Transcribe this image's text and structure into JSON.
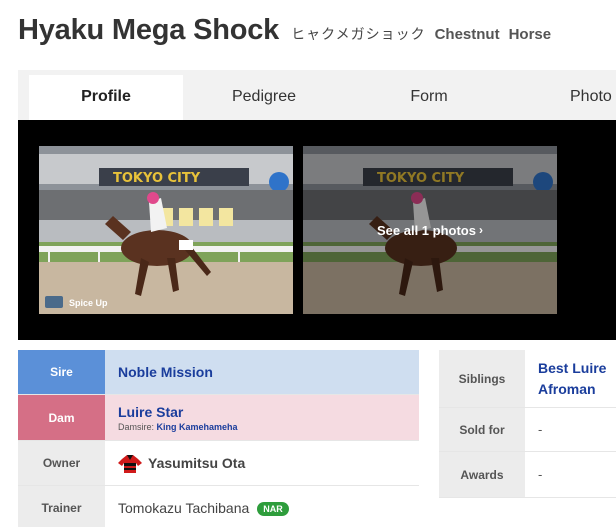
{
  "header": {
    "name": "Hyaku Mega Shock",
    "kana": "ヒャクメガショック",
    "color": "Chestnut",
    "type": "Horse"
  },
  "tabs": [
    {
      "label": "Profile",
      "active": true
    },
    {
      "label": "Pedigree",
      "active": false
    },
    {
      "label": "Form",
      "active": false
    },
    {
      "label": "Photo",
      "active": false
    }
  ],
  "gallery": {
    "credit": "Spice Up",
    "see_all": "See all 1 photos"
  },
  "profile": {
    "sire": {
      "label": "Sire",
      "value": "Noble Mission"
    },
    "dam": {
      "label": "Dam",
      "value": "Luire Star",
      "damsire_label": "Damsire:",
      "damsire": "King Kamehameha"
    },
    "owner": {
      "label": "Owner",
      "value": "Yasumitsu Ota"
    },
    "trainer": {
      "label": "Trainer",
      "value": "Tomokazu Tachibana",
      "badge": "NAR"
    }
  },
  "side": {
    "siblings": {
      "label": "Siblings",
      "values": [
        "Best Luire",
        "Afroman"
      ]
    },
    "sold_for": {
      "label": "Sold for",
      "value": "-"
    },
    "awards": {
      "label": "Awards",
      "value": "-"
    }
  },
  "colors": {
    "sire_label_bg": "#5b90d8",
    "sire_value_bg": "#cfdef0",
    "dam_label_bg": "#d56f86",
    "dam_value_bg": "#f5dbe1",
    "link": "#1a3d9c",
    "badge_nar": "#2e9d3c"
  }
}
